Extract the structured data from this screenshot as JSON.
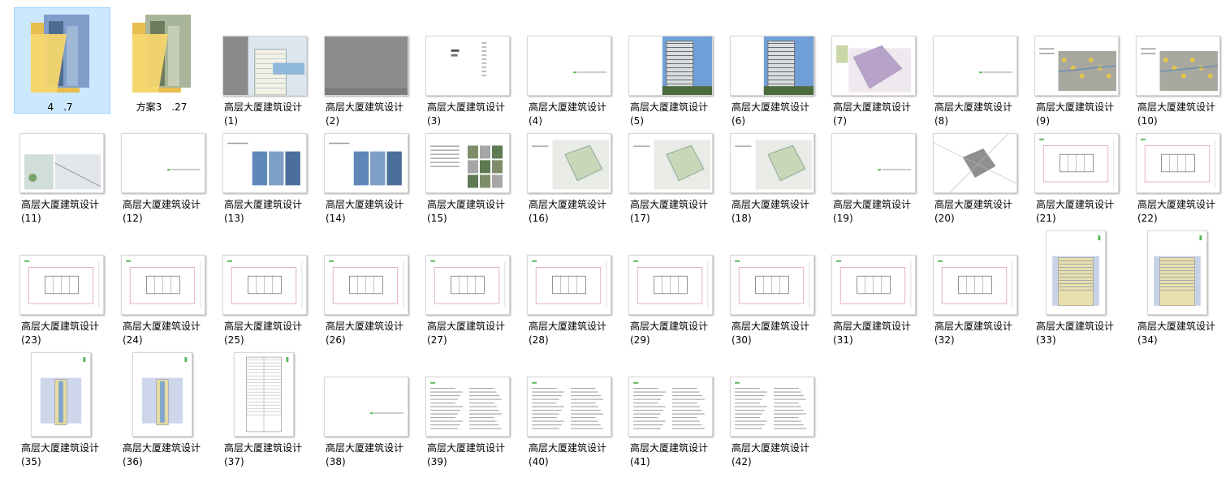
{
  "colors": {
    "selection_bg": "#cce8ff",
    "selection_border": "#99d1ff",
    "folder": "#f5d76e",
    "accent_green": "#5cb85c"
  },
  "folders": [
    {
      "label": "4　.7",
      "selected": true
    },
    {
      "label": "方案3　.27",
      "selected": false
    }
  ],
  "files": [
    {
      "name": "高层大厦建筑设计",
      "num": "(1)",
      "thumb": "render-building-icon"
    },
    {
      "name": "高层大厦建筑设计",
      "num": "(2)",
      "thumb": "gray-page-icon"
    },
    {
      "name": "高层大厦建筑设计",
      "num": "(3)",
      "thumb": "index-page-icon"
    },
    {
      "name": "高层大厦建筑设计",
      "num": "(4)",
      "thumb": "blank-title-icon"
    },
    {
      "name": "高层大厦建筑设计",
      "num": "(5)",
      "thumb": "tower-photo-icon"
    },
    {
      "name": "高层大厦建筑设计",
      "num": "(6)",
      "thumb": "tower-photo-icon"
    },
    {
      "name": "高层大厦建筑设计",
      "num": "(7)",
      "thumb": "site-map-icon"
    },
    {
      "name": "高层大厦建筑设计",
      "num": "(8)",
      "thumb": "blank-title-icon"
    },
    {
      "name": "高层大厦建筑设计",
      "num": "(9)",
      "thumb": "aerial-map-icon"
    },
    {
      "name": "高层大厦建筑设计",
      "num": "(10)",
      "thumb": "aerial-map-icon"
    },
    {
      "name": "高层大厦建筑设计",
      "num": "(11)",
      "thumb": "analysis-page-icon"
    },
    {
      "name": "高层大厦建筑设计",
      "num": "(12)",
      "thumb": "blank-title-icon"
    },
    {
      "name": "高层大厦建筑设计",
      "num": "(13)",
      "thumb": "reference-photos-icon"
    },
    {
      "name": "高层大厦建筑设计",
      "num": "(14)",
      "thumb": "reference-photos-icon"
    },
    {
      "name": "高层大厦建筑设计",
      "num": "(15)",
      "thumb": "photo-grid-icon"
    },
    {
      "name": "高层大厦建筑设计",
      "num": "(16)",
      "thumb": "site-plan-icon"
    },
    {
      "name": "高层大厦建筑设计",
      "num": "(17)",
      "thumb": "site-plan-icon"
    },
    {
      "name": "高层大厦建筑设计",
      "num": "(18)",
      "thumb": "site-plan-icon"
    },
    {
      "name": "高层大厦建筑设计",
      "num": "(19)",
      "thumb": "blank-title-icon"
    },
    {
      "name": "高层大厦建筑设计",
      "num": "(20)",
      "thumb": "master-plan-icon"
    },
    {
      "name": "高层大厦建筑设计",
      "num": "(21)",
      "thumb": "floor-plan-icon"
    },
    {
      "name": "高层大厦建筑设计",
      "num": "(22)",
      "thumb": "floor-plan-icon"
    },
    {
      "name": "高层大厦建筑设计",
      "num": "(23)",
      "thumb": "floor-plan-icon"
    },
    {
      "name": "高层大厦建筑设计",
      "num": "(24)",
      "thumb": "floor-plan-icon"
    },
    {
      "name": "高层大厦建筑设计",
      "num": "(25)",
      "thumb": "floor-plan-icon"
    },
    {
      "name": "高层大厦建筑设计",
      "num": "(26)",
      "thumb": "floor-plan-icon"
    },
    {
      "name": "高层大厦建筑设计",
      "num": "(27)",
      "thumb": "floor-plan-icon"
    },
    {
      "name": "高层大厦建筑设计",
      "num": "(28)",
      "thumb": "floor-plan-icon"
    },
    {
      "name": "高层大厦建筑设计",
      "num": "(29)",
      "thumb": "floor-plan-icon"
    },
    {
      "name": "高层大厦建筑设计",
      "num": "(30)",
      "thumb": "floor-plan-icon"
    },
    {
      "name": "高层大厦建筑设计",
      "num": "(31)",
      "thumb": "floor-plan-icon"
    },
    {
      "name": "高层大厦建筑设计",
      "num": "(32)",
      "thumb": "floor-plan-icon"
    },
    {
      "name": "高层大厦建筑设计",
      "num": "(33)",
      "thumb": "elevation-icon"
    },
    {
      "name": "高层大厦建筑设计",
      "num": "(34)",
      "thumb": "elevation-icon"
    },
    {
      "name": "高层大厦建筑设计",
      "num": "(35)",
      "thumb": "side-elevation-icon"
    },
    {
      "name": "高层大厦建筑设计",
      "num": "(36)",
      "thumb": "side-elevation-icon"
    },
    {
      "name": "高层大厦建筑设计",
      "num": "(37)",
      "thumb": "section-icon"
    },
    {
      "name": "高层大厦建筑设计",
      "num": "(38)",
      "thumb": "blank-title-icon"
    },
    {
      "name": "高层大厦建筑设计",
      "num": "(39)",
      "thumb": "text-doc-icon"
    },
    {
      "name": "高层大厦建筑设计",
      "num": "(40)",
      "thumb": "text-doc-icon"
    },
    {
      "name": "高层大厦建筑设计",
      "num": "(41)",
      "thumb": "text-doc-icon"
    },
    {
      "name": "高层大厦建筑设计",
      "num": "(42)",
      "thumb": "text-doc-icon"
    }
  ]
}
